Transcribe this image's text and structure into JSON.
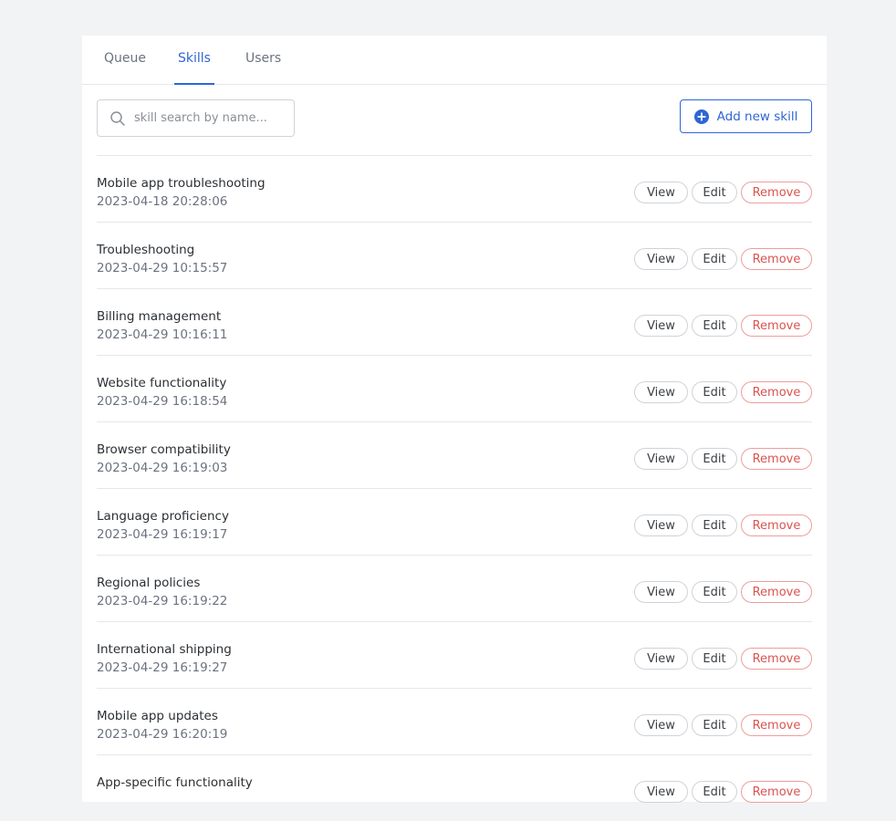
{
  "tabs": [
    {
      "label": "Queue",
      "active": false
    },
    {
      "label": "Skills",
      "active": true
    },
    {
      "label": "Users",
      "active": false
    }
  ],
  "search": {
    "placeholder": "skill search by name...",
    "value": "",
    "icon": "search-icon"
  },
  "add_button": {
    "label": "Add new skill",
    "icon": "plus-circle-icon"
  },
  "actions": {
    "view": "View",
    "edit": "Edit",
    "remove": "Remove"
  },
  "skills": [
    {
      "name": "Mobile app troubleshooting",
      "date": "2023-04-18 20:28:06"
    },
    {
      "name": "Troubleshooting",
      "date": "2023-04-29 10:15:57"
    },
    {
      "name": "Billing management",
      "date": "2023-04-29 10:16:11"
    },
    {
      "name": "Website functionality",
      "date": "2023-04-29 16:18:54"
    },
    {
      "name": "Browser compatibility",
      "date": "2023-04-29 16:19:03"
    },
    {
      "name": "Language proficiency",
      "date": "2023-04-29 16:19:17"
    },
    {
      "name": "Regional policies",
      "date": "2023-04-29 16:19:22"
    },
    {
      "name": "International shipping",
      "date": "2023-04-29 16:19:27"
    },
    {
      "name": "Mobile app updates",
      "date": "2023-04-29 16:20:19"
    },
    {
      "name": "App-specific functionality",
      "date": ""
    }
  ],
  "colors": {
    "accent": "#2f66d4",
    "danger": "#d9534f",
    "background": "#f2f3f5"
  }
}
